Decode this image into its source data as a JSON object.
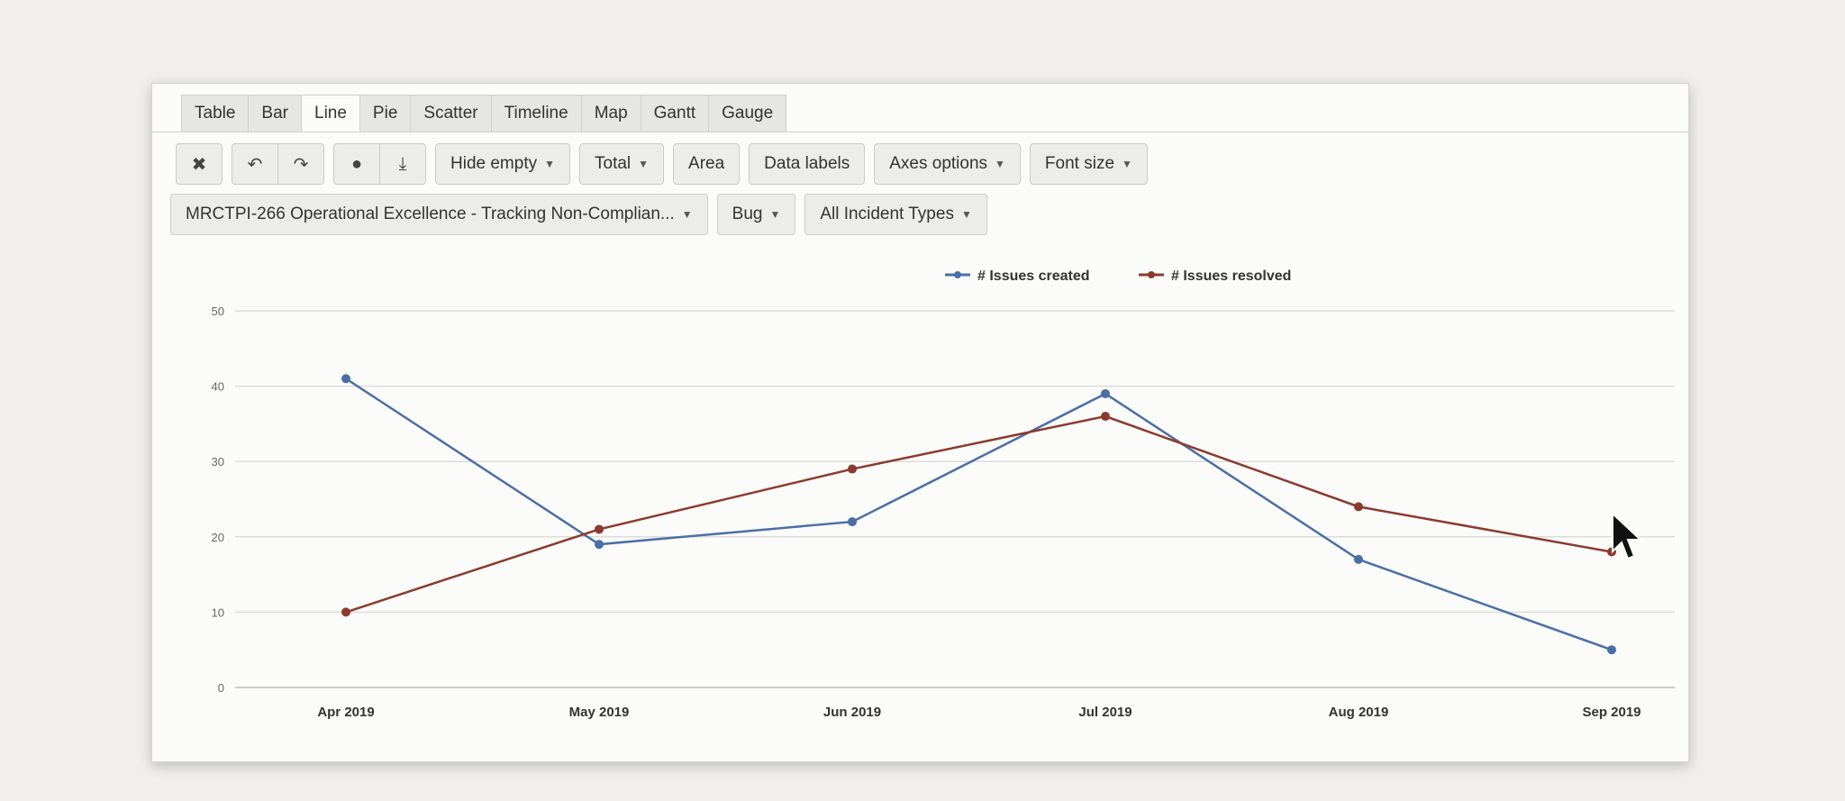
{
  "tabs": [
    "Table",
    "Bar",
    "Line",
    "Pie",
    "Scatter",
    "Timeline",
    "Map",
    "Gantt",
    "Gauge"
  ],
  "active_tab": "Line",
  "toolbar": {
    "hide_empty": "Hide empty",
    "total": "Total",
    "area": "Area",
    "data_labels": "Data labels",
    "axes_options": "Axes options",
    "font_size": "Font size"
  },
  "filters": {
    "project": "MRCTPI-266 Operational Excellence - Tracking Non-Complian...",
    "issue_type": "Bug",
    "incident_types": "All Incident Types"
  },
  "chart_data": {
    "type": "line",
    "categories": [
      "Apr 2019",
      "May 2019",
      "Jun 2019",
      "Jul 2019",
      "Aug 2019",
      "Sep 2019"
    ],
    "series": [
      {
        "name": "# Issues created",
        "values": [
          41,
          19,
          22,
          39,
          17,
          5
        ],
        "color": "#4a6fa5"
      },
      {
        "name": "# Issues resolved",
        "values": [
          10,
          21,
          29,
          36,
          24,
          18
        ],
        "color": "#8b3a2e"
      }
    ],
    "yticks": [
      0,
      10,
      20,
      30,
      40,
      50
    ],
    "ylim": [
      0,
      50
    ],
    "grid": true,
    "legend": "top-center"
  }
}
